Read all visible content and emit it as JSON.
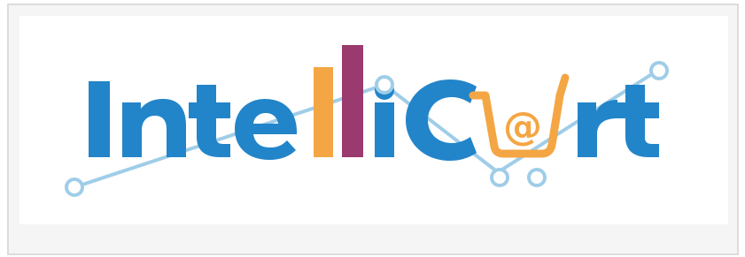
{
  "logo": {
    "text": "IntelliCart",
    "icon": "shopping-cart-at-sign-icon",
    "colors": {
      "blue": "#2385c9",
      "orange": "#f4a644",
      "purple": "#9b3a6e",
      "line": "#9fcde8",
      "background": "#ffffff"
    }
  }
}
